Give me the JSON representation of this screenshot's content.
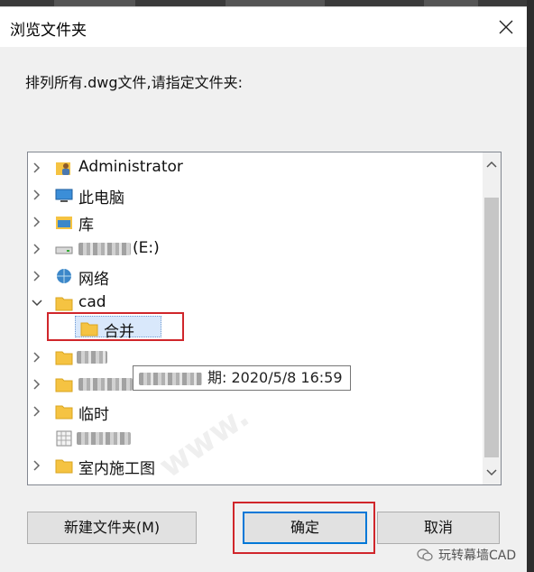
{
  "dialog": {
    "title": "浏览文件夹",
    "instruction": "排列所有.dwg文件,请指定文件夹:"
  },
  "tree": {
    "items": [
      {
        "label": "Administrator",
        "icon": "user-folder-icon",
        "expandable": true
      },
      {
        "label": "此电脑",
        "icon": "computer-icon",
        "expandable": true
      },
      {
        "label": "库",
        "icon": "library-icon",
        "expandable": true
      },
      {
        "label": "(E:)",
        "icon": "drive-icon",
        "expandable": true,
        "blurred_prefix": true
      },
      {
        "label": "网络",
        "icon": "network-icon",
        "expandable": true
      },
      {
        "label": "cad",
        "icon": "folder-icon",
        "expanded": true
      },
      {
        "label": "合并",
        "icon": "folder-icon",
        "selected": true
      },
      {
        "label": "",
        "icon": "folder-icon",
        "expandable": true,
        "blurred": true
      },
      {
        "label": "",
        "icon": "folder-icon",
        "expandable": true,
        "blurred": true
      },
      {
        "label": "临时",
        "icon": "folder-icon",
        "expandable": true
      },
      {
        "label": "",
        "icon": "file-grid-icon",
        "blurred": true
      },
      {
        "label": "室内施工图",
        "icon": "folder-icon",
        "expandable": true
      }
    ],
    "tooltip": "期: 2020/5/8 16:59"
  },
  "buttons": {
    "new_folder": "新建文件夹(M)",
    "ok": "确定",
    "cancel": "取消"
  },
  "brand": {
    "text": "玩转幕墙CAD"
  },
  "colors": {
    "highlight_red": "#d0262b",
    "focus_blue": "#0078d7",
    "folder_yellow": "#f5c342",
    "selection_bg": "#d9e8fb"
  }
}
